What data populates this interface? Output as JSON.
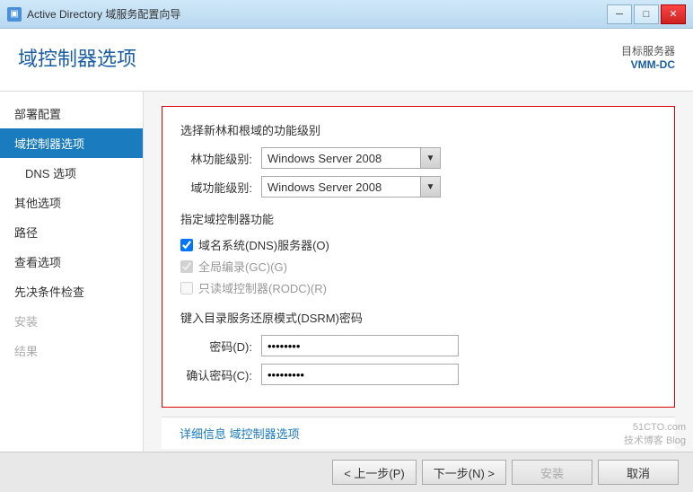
{
  "titlebar": {
    "title": "Active Directory 域服务配置向导",
    "icon_label": "AD",
    "btn_minimize": "─",
    "btn_restore": "□",
    "btn_close": "✕"
  },
  "header": {
    "title": "域控制器选项",
    "target_label": "目标服务器",
    "target_value": "VMM-DC"
  },
  "sidebar": {
    "items": [
      {
        "label": "部署配置",
        "state": "normal",
        "indented": false
      },
      {
        "label": "域控制器选项",
        "state": "active",
        "indented": false
      },
      {
        "label": "DNS 选项",
        "state": "normal",
        "indented": true
      },
      {
        "label": "其他选项",
        "state": "normal",
        "indented": false
      },
      {
        "label": "路径",
        "state": "normal",
        "indented": false
      },
      {
        "label": "查看选项",
        "state": "normal",
        "indented": false
      },
      {
        "label": "先决条件检查",
        "state": "normal",
        "indented": false
      },
      {
        "label": "安装",
        "state": "disabled",
        "indented": false
      },
      {
        "label": "结果",
        "state": "disabled",
        "indented": false
      }
    ]
  },
  "main": {
    "section1_title": "选择新林和根域的功能级别",
    "forest_label": "林功能级别:",
    "forest_value": "Windows Server 2008",
    "domain_label": "域功能级别:",
    "domain_value": "Windows Server 2008",
    "section2_title": "指定域控制器功能",
    "checkbox1_label": "域名系统(DNS)服务器(O)",
    "checkbox1_checked": true,
    "checkbox1_disabled": false,
    "checkbox2_label": "全局编录(GC)(G)",
    "checkbox2_checked": true,
    "checkbox2_disabled": true,
    "checkbox3_label": "只读域控制器(RODC)(R)",
    "checkbox3_checked": false,
    "checkbox3_disabled": true,
    "section3_title": "键入目录服务还原模式(DSRM)密码",
    "password_label": "密码(D):",
    "password_value": "••••••••",
    "confirm_label": "确认密码(C):",
    "confirm_value": "•••••••••",
    "link_label": "详细信息 域控制器选项"
  },
  "footer": {
    "back_btn": "< 上一步(P)",
    "next_btn": "下一步(N) >",
    "install_btn": "安装",
    "cancel_btn": "取消"
  },
  "watermark": {
    "line1": "51CTO.com",
    "line2": "技术博客 Blog"
  }
}
